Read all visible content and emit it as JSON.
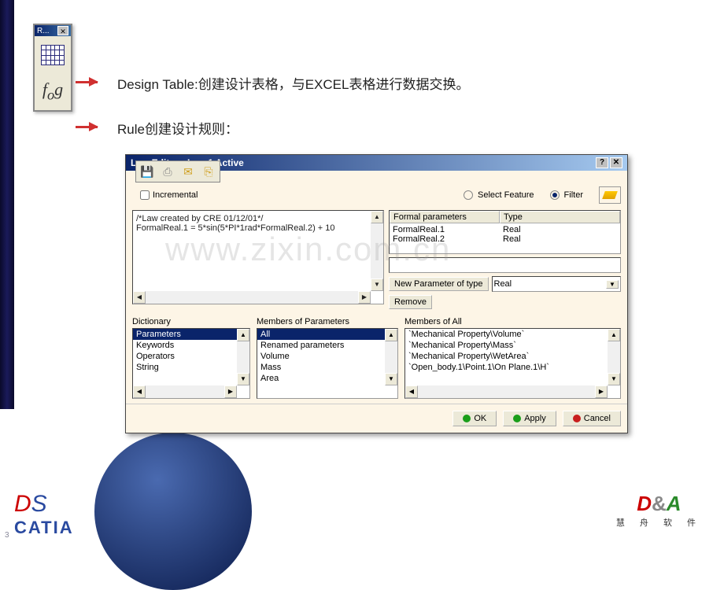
{
  "toolbar": {
    "title": "R..."
  },
  "labels": {
    "design_table": "Design Table:创建设计表格，与EXCEL表格进行数据交换。",
    "rule": "Rule创建设计规则："
  },
  "dialog": {
    "title": "Law Editor : Law.1 Active",
    "incremental_label": "Incremental",
    "select_feature_label": "Select Feature",
    "filter_label": "Filter",
    "code_line1": "/*Law created by CRE 01/12/01*/",
    "code_line2": "FormalReal.1 = 5*sin(5*PI*1rad*FormalReal.2) + 10",
    "formal_params_header": "Formal parameters",
    "type_header": "Type",
    "params": [
      {
        "name": "FormalReal.1",
        "type": "Real"
      },
      {
        "name": "FormalReal.2",
        "type": "Real"
      }
    ],
    "new_param_btn": "New Parameter of type",
    "new_param_type": "Real",
    "remove_btn": "Remove",
    "dictionary": {
      "label": "Dictionary",
      "items": [
        "Parameters",
        "Keywords",
        "Operators",
        "String"
      ]
    },
    "members_params": {
      "label": "Members of Parameters",
      "items": [
        "All",
        "Renamed parameters",
        "Volume",
        "Mass",
        "Area"
      ]
    },
    "members_all": {
      "label": "Members of All",
      "items": [
        "`Mechanical Property\\Volume`",
        "`Mechanical Property\\Mass`",
        "`Mechanical Property\\WetArea`",
        "`Open_body.1\\Point.1\\On Plane.1\\H`"
      ]
    },
    "ok_btn": "OK",
    "apply_btn": "Apply",
    "cancel_btn": "Cancel"
  },
  "watermark": "www.zixin.com.cn",
  "logos": {
    "catia": "CATIA",
    "da_cn": "慧 舟 软 件"
  },
  "page_number": "3"
}
